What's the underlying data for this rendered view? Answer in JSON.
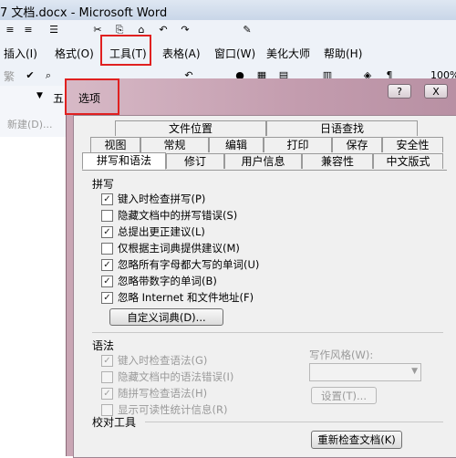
{
  "window": {
    "title": "7 文档.docx - Microsoft Word"
  },
  "menubar": {
    "insert": "插入(I)",
    "format": "格式(O)",
    "tools": "工具(T)",
    "table": "表格(A)",
    "window": "窗口(W)",
    "beautify": "美化大师",
    "help": "帮助(H)"
  },
  "toolbar": {
    "zoom": "100%",
    "style_char": "繁",
    "font_char": "五",
    "new_label": "新建(D)..."
  },
  "dialog": {
    "title": "选项",
    "help_btn": "?",
    "close_btn": "X",
    "tabs_row1": [
      "文件位置",
      "日语查找"
    ],
    "tabs_row2": [
      "视图",
      "常规",
      "编辑",
      "打印",
      "保存",
      "安全性"
    ],
    "tabs_row3": [
      "拼写和语法",
      "修订",
      "用户信息",
      "兼容性",
      "中文版式"
    ],
    "spelling": {
      "heading": "拼写",
      "options": [
        {
          "label": "键入时检查拼写(P)",
          "checked": true
        },
        {
          "label": "隐藏文档中的拼写错误(S)",
          "checked": false
        },
        {
          "label": "总提出更正建议(L)",
          "checked": true
        },
        {
          "label": "仅根据主词典提供建议(M)",
          "checked": false
        },
        {
          "label": "忽略所有字母都大写的单词(U)",
          "checked": true
        },
        {
          "label": "忽略带数字的单词(B)",
          "checked": true
        },
        {
          "label": "忽略 Internet 和文件地址(F)",
          "checked": true
        }
      ],
      "custom_dict_btn": "自定义词典(D)..."
    },
    "grammar": {
      "heading": "语法",
      "options": [
        {
          "label": "键入时检查语法(G)",
          "checked": true
        },
        {
          "label": "隐藏文档中的语法错误(I)",
          "checked": false
        },
        {
          "label": "随拼写检查语法(H)",
          "checked": true
        },
        {
          "label": "显示可读性统计信息(R)",
          "checked": false
        }
      ],
      "style_label": "写作风格(W):",
      "style_value": "",
      "settings_btn": "设置(T)..."
    },
    "proofing": {
      "heading": "校对工具",
      "recheck_btn": "重新检查文档(K)"
    }
  },
  "colors": {
    "highlight": "#e02020",
    "dialog_frame": "#c9a6b4"
  }
}
